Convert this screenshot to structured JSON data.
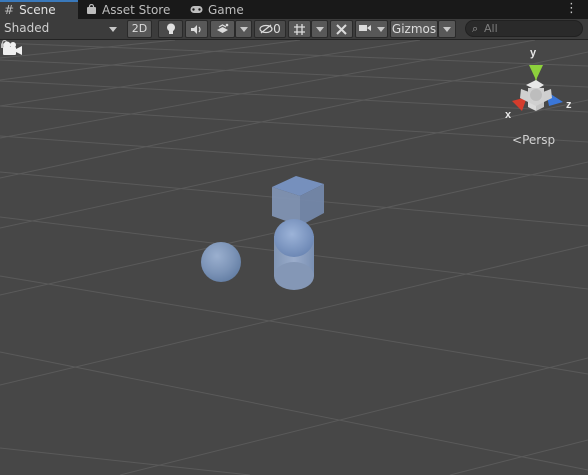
{
  "tabs": [
    {
      "label": "Scene",
      "icon": "hash-grid-icon",
      "active": true
    },
    {
      "label": "Asset Store",
      "icon": "shopping-bag-icon",
      "active": false
    },
    {
      "label": "Game",
      "icon": "gamepad-icon",
      "active": false
    }
  ],
  "toolbar": {
    "draw_mode": "Shaded",
    "mode_2d": "2D",
    "hidden_count": "0",
    "gizmos_label": "Gizmos",
    "search_placeholder": "All"
  },
  "scene": {
    "projection_label": "Persp",
    "axes": {
      "x": "x",
      "y": "y",
      "z": "z"
    },
    "objects": [
      "cube",
      "sphere",
      "capsule"
    ],
    "colors": {
      "background": "#474747",
      "axis_x": "#d43c2c",
      "axis_y": "#8dd13c",
      "axis_z": "#3a76d8",
      "primitive": "#7f98bd"
    }
  }
}
